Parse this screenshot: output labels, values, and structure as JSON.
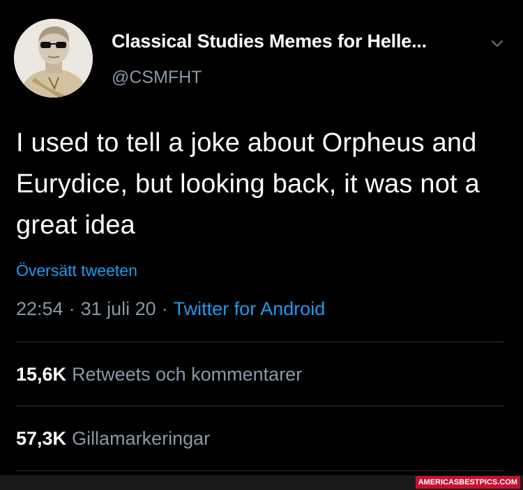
{
  "tweet": {
    "author_name": "Classical Studies Memes for Helle...",
    "author_handle": "@CSMFHT",
    "text": "I used to tell a joke about Orpheus and Eurydice, but looking back, it was not a great idea",
    "translate_label": "Översätt tweeten",
    "time": "22:54",
    "date": "31 juli 20",
    "separator": "·",
    "source": "Twitter for Android",
    "retweets": {
      "count": "15,6K",
      "label": "Retweets och kommentarer"
    },
    "likes": {
      "count": "57,3K",
      "label": "Gillamarkeringar"
    }
  },
  "icons": {
    "menu": "chevron-down-icon",
    "avatar": "bust-with-sunglasses"
  },
  "watermark": "AMERICASBESTPICS.COM",
  "colors": {
    "background": "#000000",
    "text": "#ffffff",
    "muted": "#8b98a5",
    "link": "#1d9bf0",
    "divider": "#2f3336",
    "watermark_bg": "#c8102e"
  }
}
